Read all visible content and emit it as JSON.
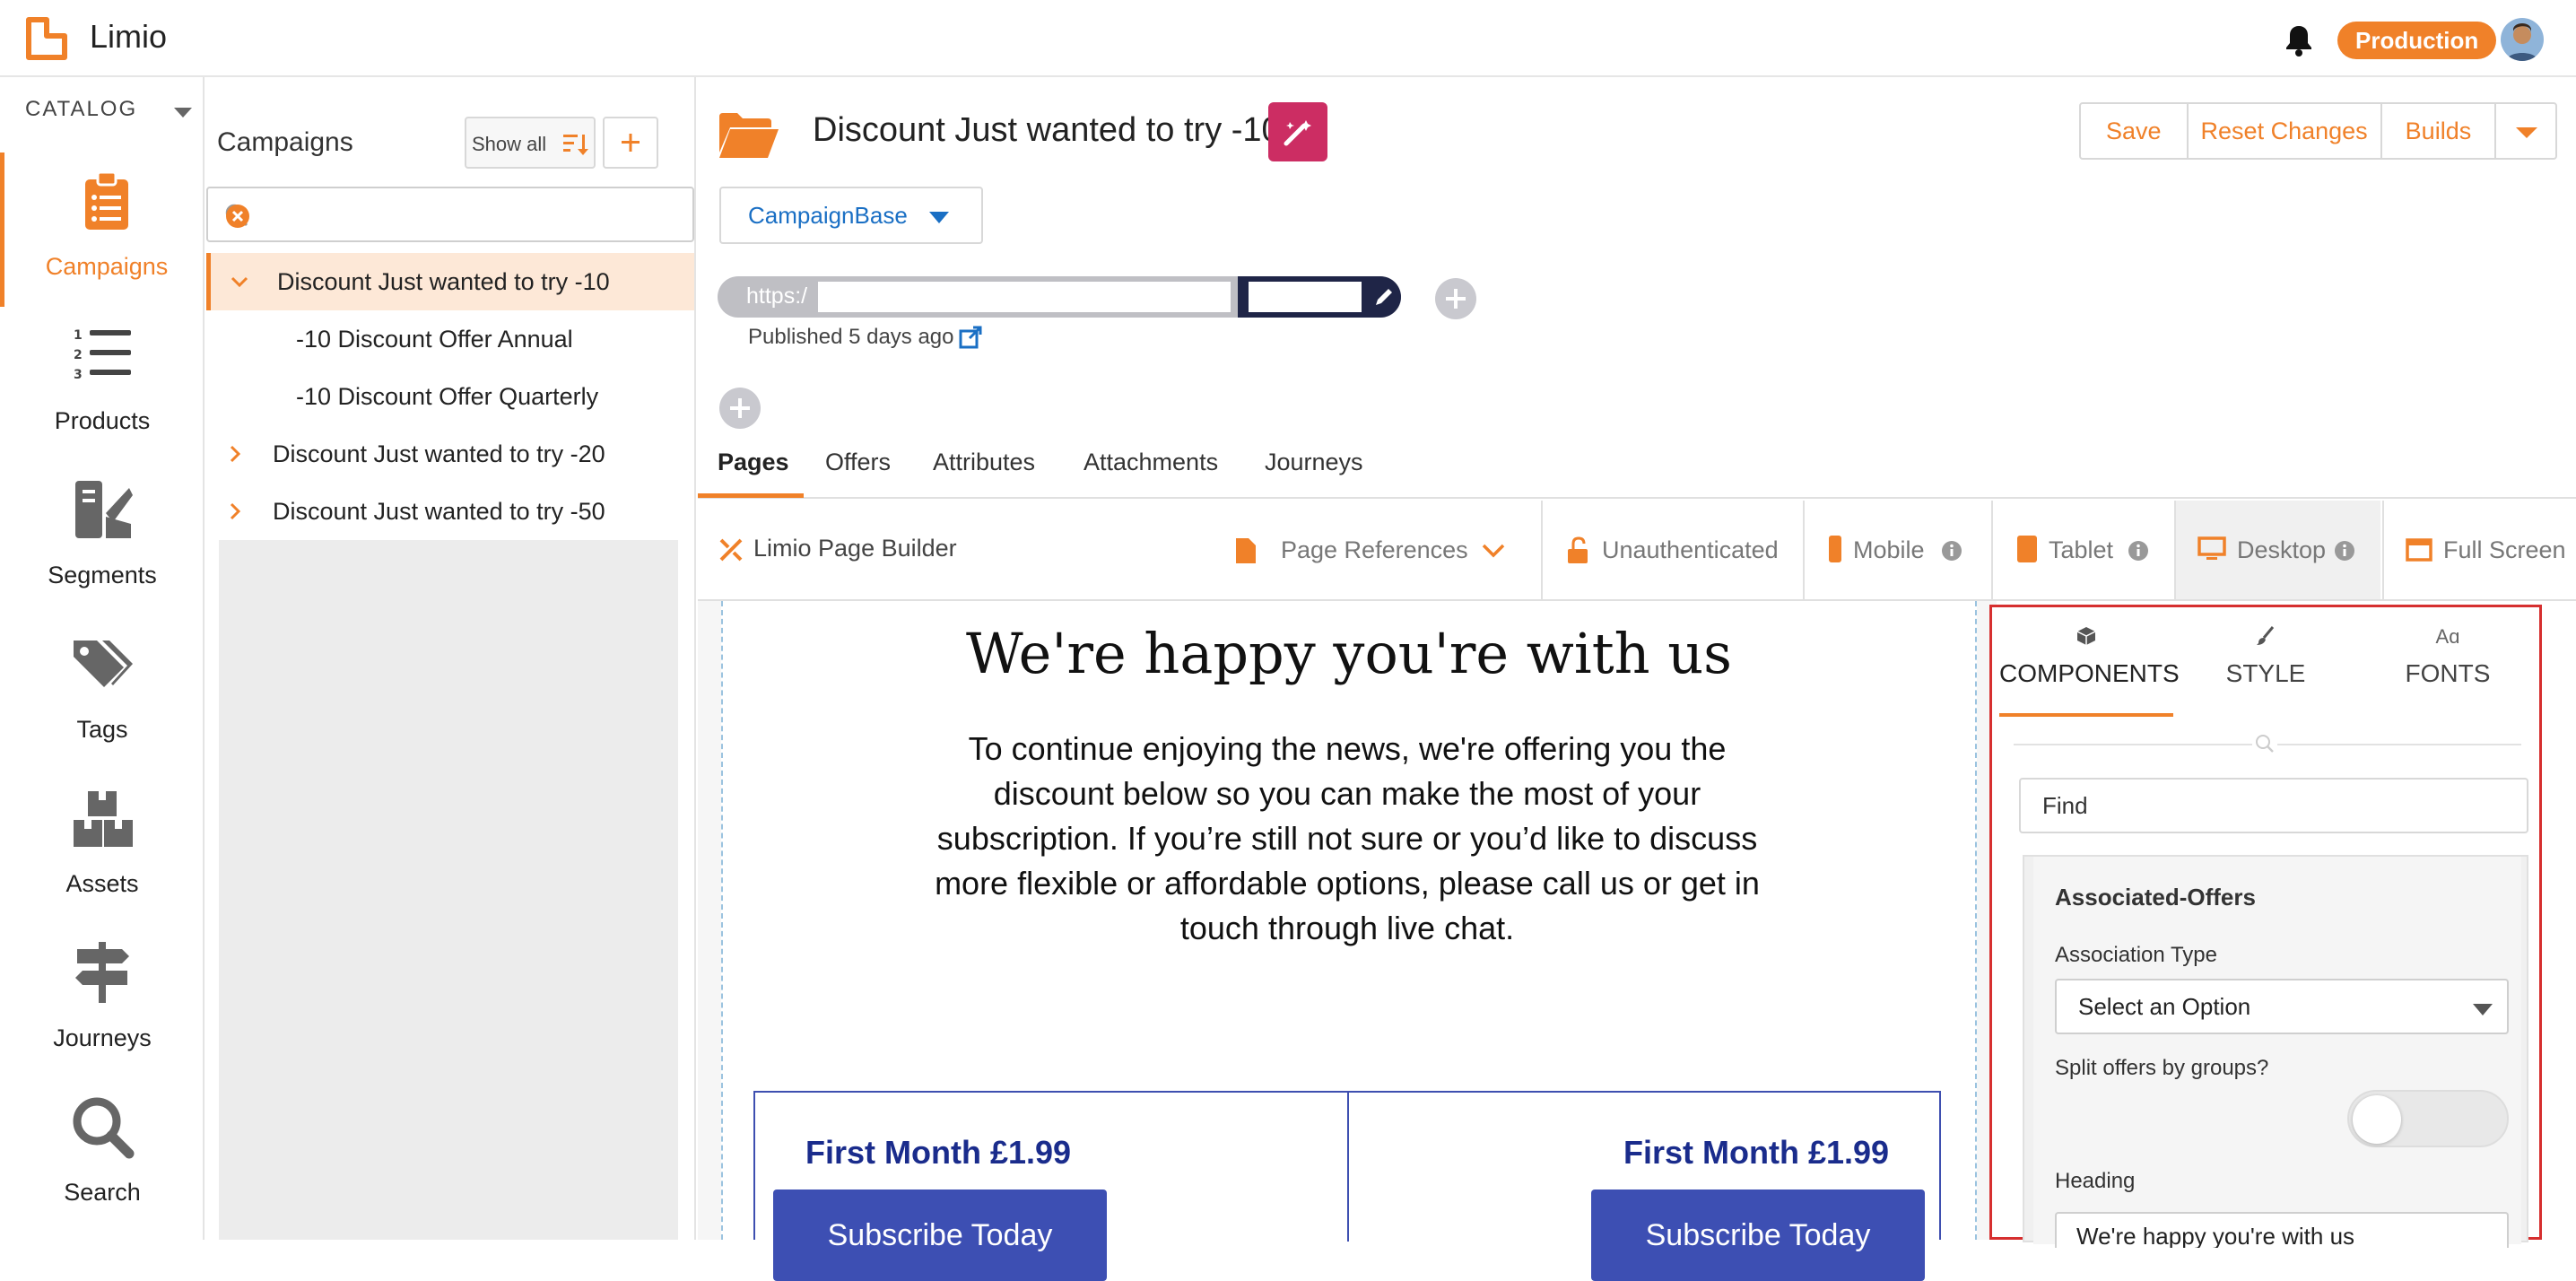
{
  "app": {
    "name": "Limio",
    "env": "Production"
  },
  "nav": {
    "catalog": "CATALOG",
    "items": [
      {
        "label": "Campaigns",
        "icon": "clipboard-list-icon",
        "active": true
      },
      {
        "label": "Products",
        "icon": "numbered-list-icon"
      },
      {
        "label": "Segments",
        "icon": "segments-icon"
      },
      {
        "label": "Tags",
        "icon": "tags-icon"
      },
      {
        "label": "Assets",
        "icon": "assets-boxes-icon"
      },
      {
        "label": "Journeys",
        "icon": "signpost-icon"
      },
      {
        "label": "Search",
        "icon": "search-icon"
      }
    ]
  },
  "campaigns": {
    "title": "Campaigns",
    "show_all": "Show all",
    "search_placeholder": "",
    "tree": [
      {
        "label": "Discount Just wanted to try -10",
        "expanded": true,
        "selected": true
      },
      {
        "label": "-10 Discount Offer Annual",
        "child": true
      },
      {
        "label": "-10 Discount Offer Quarterly",
        "child": true
      },
      {
        "label": "Discount Just wanted to try -20"
      },
      {
        "label": "Discount Just wanted to try -50"
      }
    ]
  },
  "main": {
    "title": "Discount Just wanted to try -10",
    "actions": {
      "save": "Save",
      "reset": "Reset Changes",
      "builds": "Builds"
    },
    "campaign_base": "CampaignBase",
    "url_prefix": "https:/",
    "published": "Published 5 days ago",
    "tabs": [
      "Pages",
      "Offers",
      "Attributes",
      "Attachments",
      "Journeys"
    ],
    "active_tab": "Pages"
  },
  "builder": {
    "title": "Limio Page Builder",
    "page_refs": "Page References",
    "unauth": "Unauthenticated",
    "mobile": "Mobile",
    "tablet": "Tablet",
    "desktop": "Desktop",
    "fullscreen": "Full Screen"
  },
  "preview": {
    "heading": "We're happy you're with us",
    "body": "To continue enjoying the news, we're offering you the discount below so you can make the most of your subscription. If you’re still not sure or you’d like to discuss more flexible or affordable options, please call us or get in touch through live chat.",
    "offers": [
      {
        "price": "First Month £1.99",
        "cta": "Subscribe Today"
      },
      {
        "price": "First Month £1.99",
        "cta": "Subscribe Today"
      }
    ]
  },
  "panel": {
    "tabs": [
      {
        "label": "COMPONENTS",
        "icon": "cube-icon",
        "active": true
      },
      {
        "label": "STYLE",
        "icon": "brush-icon"
      },
      {
        "label": "FONTS",
        "icon": "font-icon",
        "glyph": "Aɑ"
      }
    ],
    "find_placeholder": "Find",
    "component": {
      "title": "Associated-Offers",
      "association_label": "Association Type",
      "association_value": "Select an Option",
      "split_label": "Split offers by groups?",
      "split_on": false,
      "heading_label": "Heading",
      "heading_value": "We're happy you're with us"
    }
  },
  "colors": {
    "accent": "#f08129",
    "primary_blue": "#3d4fb3",
    "magic": "#cc2d63",
    "highlight": "#d62f2f"
  }
}
